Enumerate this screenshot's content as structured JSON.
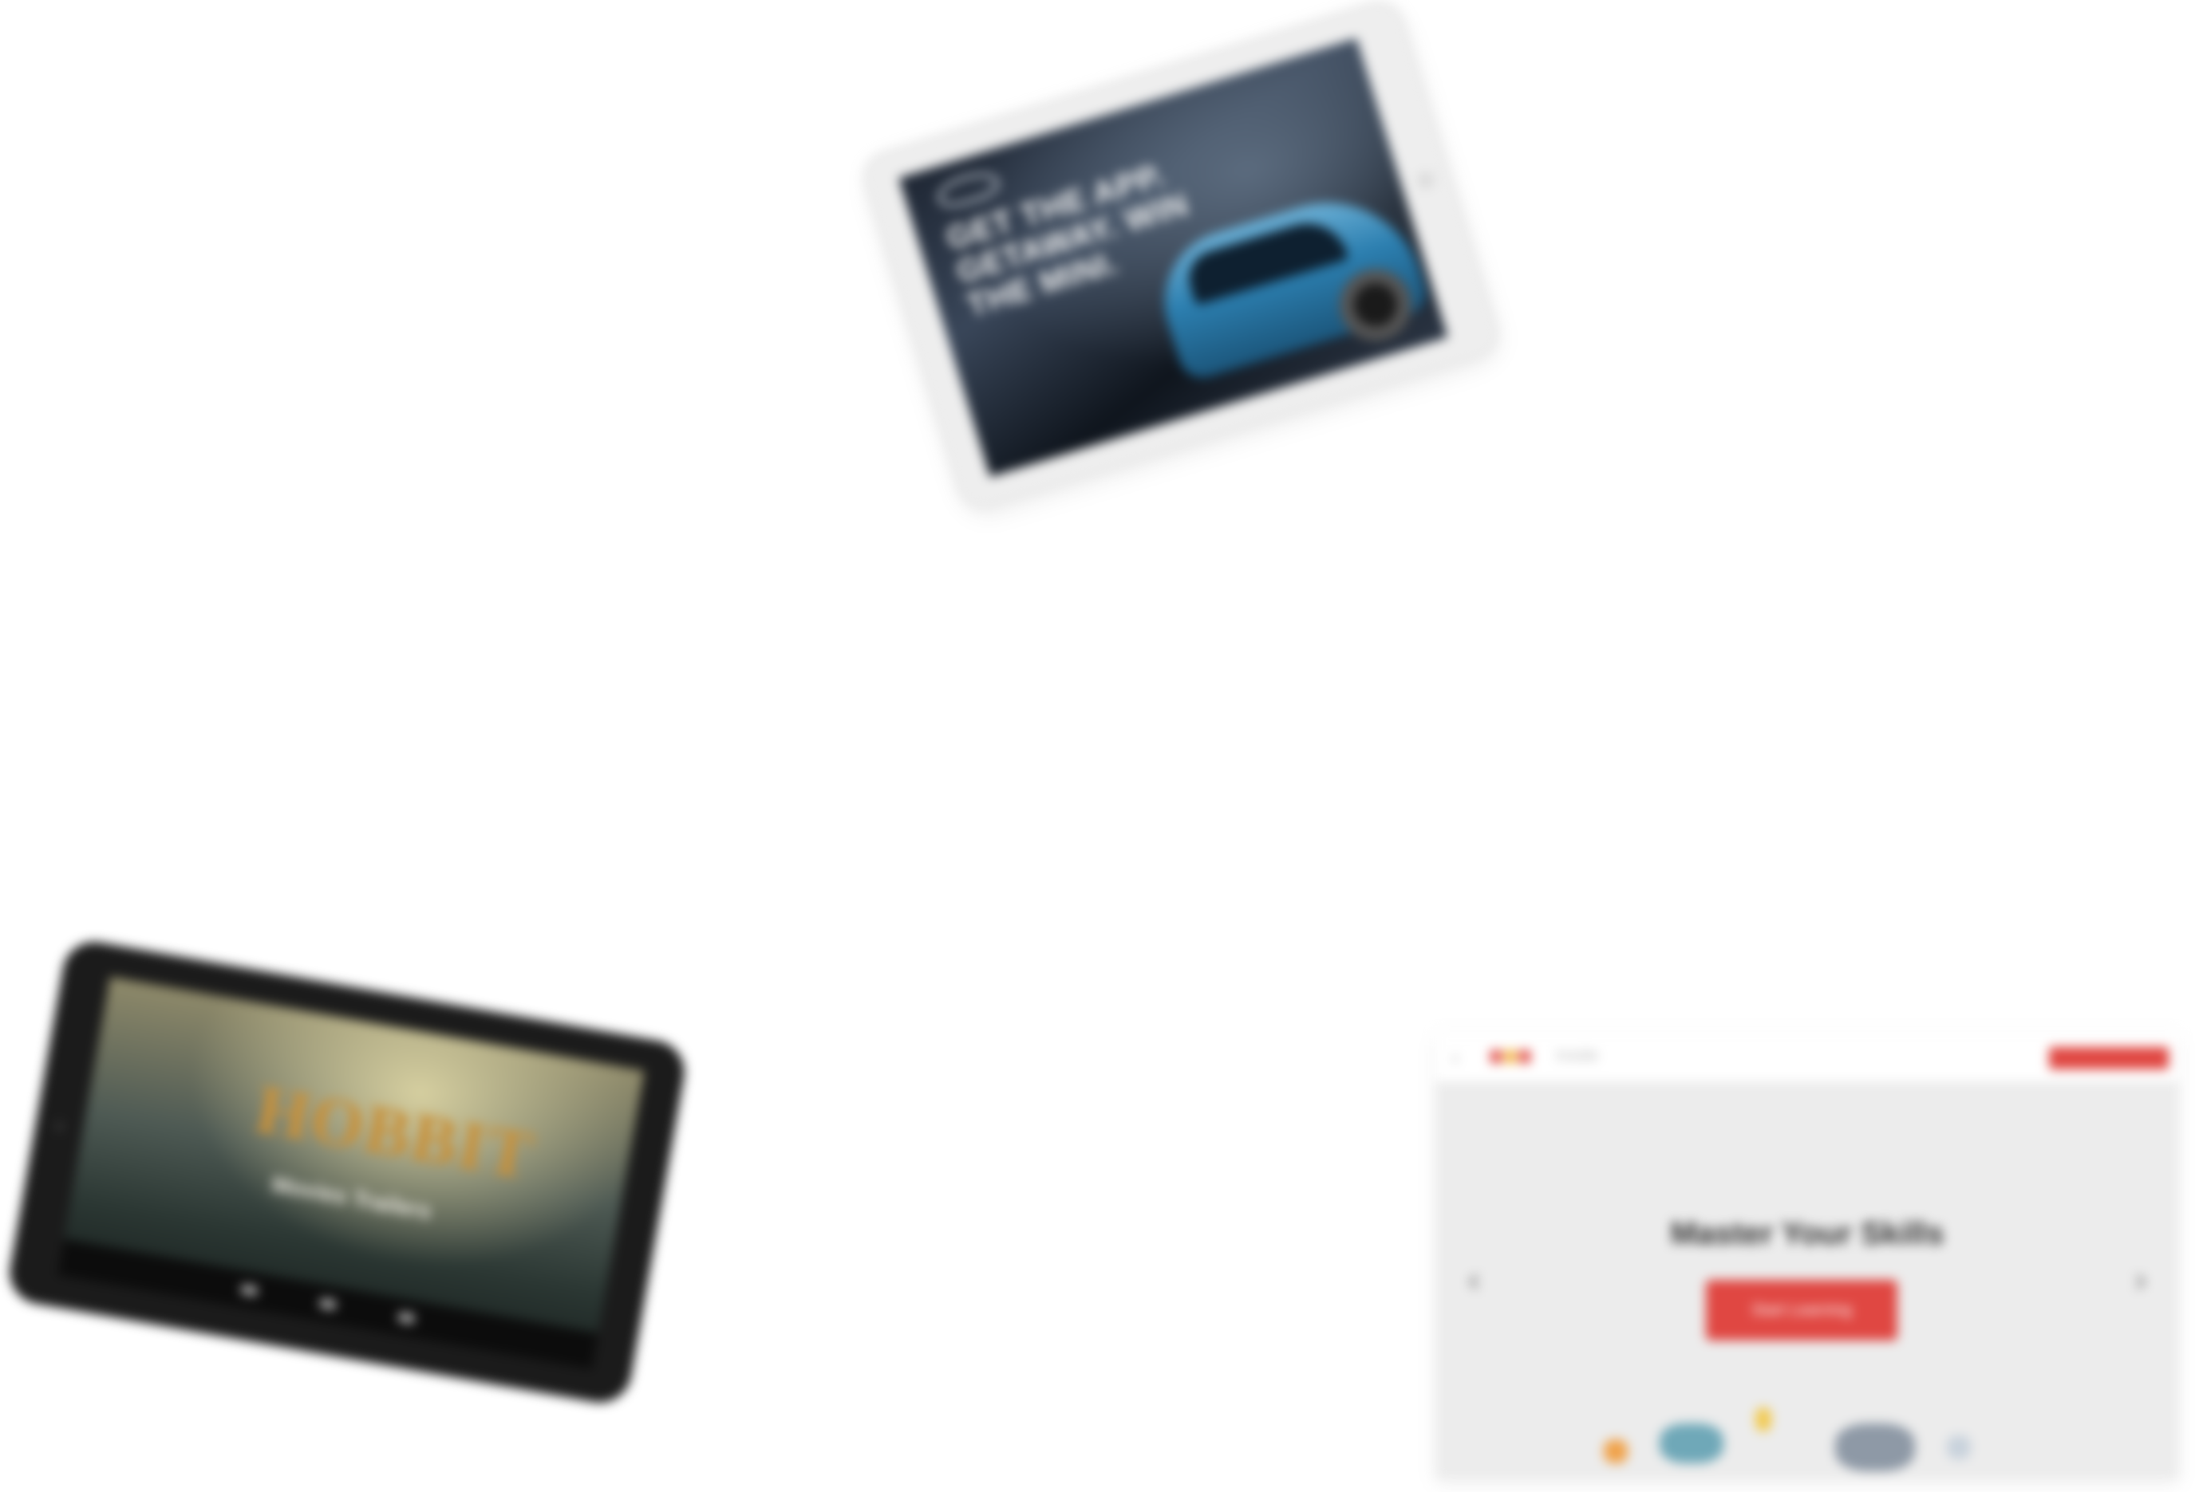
{
  "ipad": {
    "headline": "GET THE APP. GETAWAY. WIN THE MINI."
  },
  "nexus": {
    "movie_title": "HOBBIT",
    "subtitle": "Movies Trailers"
  },
  "browser": {
    "url_text": "Inside",
    "top_button_label": "",
    "hero_title": "Master Your Skills",
    "cta_label": "Start Learning",
    "prev_label": "‹",
    "next_label": "›",
    "back_icon": "back-arrow-icon",
    "accent_color": "#e04742"
  }
}
